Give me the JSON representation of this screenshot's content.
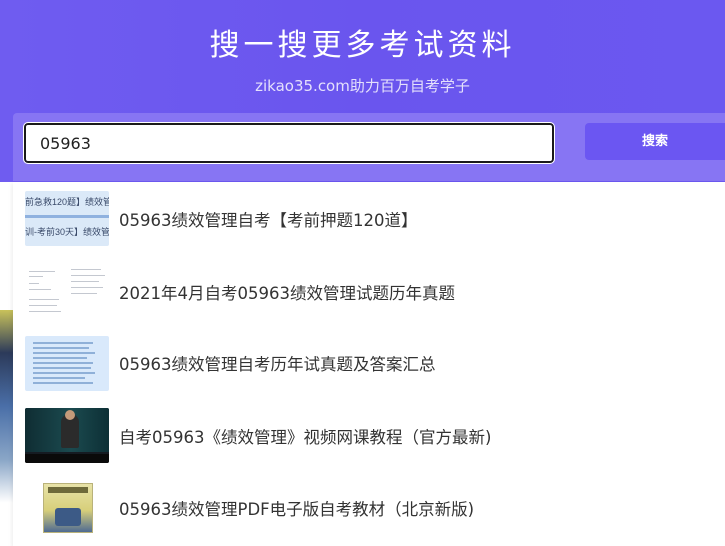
{
  "hero": {
    "title": "搜一搜更多考试资料",
    "subtitle": "zikao35.com助力百万自考学子"
  },
  "search": {
    "value": "05963",
    "button_label": "搜索"
  },
  "colors": {
    "hero_bg": "#6a55ee",
    "search_band": "#8775f3",
    "button_bg": "#6b56f2",
    "text": "#333333"
  },
  "suggestions": [
    {
      "text": "05963绩效管理自考【考前押题120道】",
      "thumb": "doc-thumbnail",
      "thumb_lines": [
        "前急救120题】绩效管",
        "训-考前30天】绩效管理"
      ]
    },
    {
      "text": "2021年4月自考05963绩效管理试题历年真题",
      "thumb": "exam-paper-thumbnail"
    },
    {
      "text": "05963绩效管理自考历年试真题及答案汇总",
      "thumb": "answer-sheet-thumbnail"
    },
    {
      "text": "自考05963《绩效管理》视频网课教程（官方最新)",
      "thumb": "video-thumbnail"
    },
    {
      "text": "05963绩效管理PDF电子版自考教材（北京新版)",
      "thumb": "textbook-thumbnail"
    }
  ]
}
